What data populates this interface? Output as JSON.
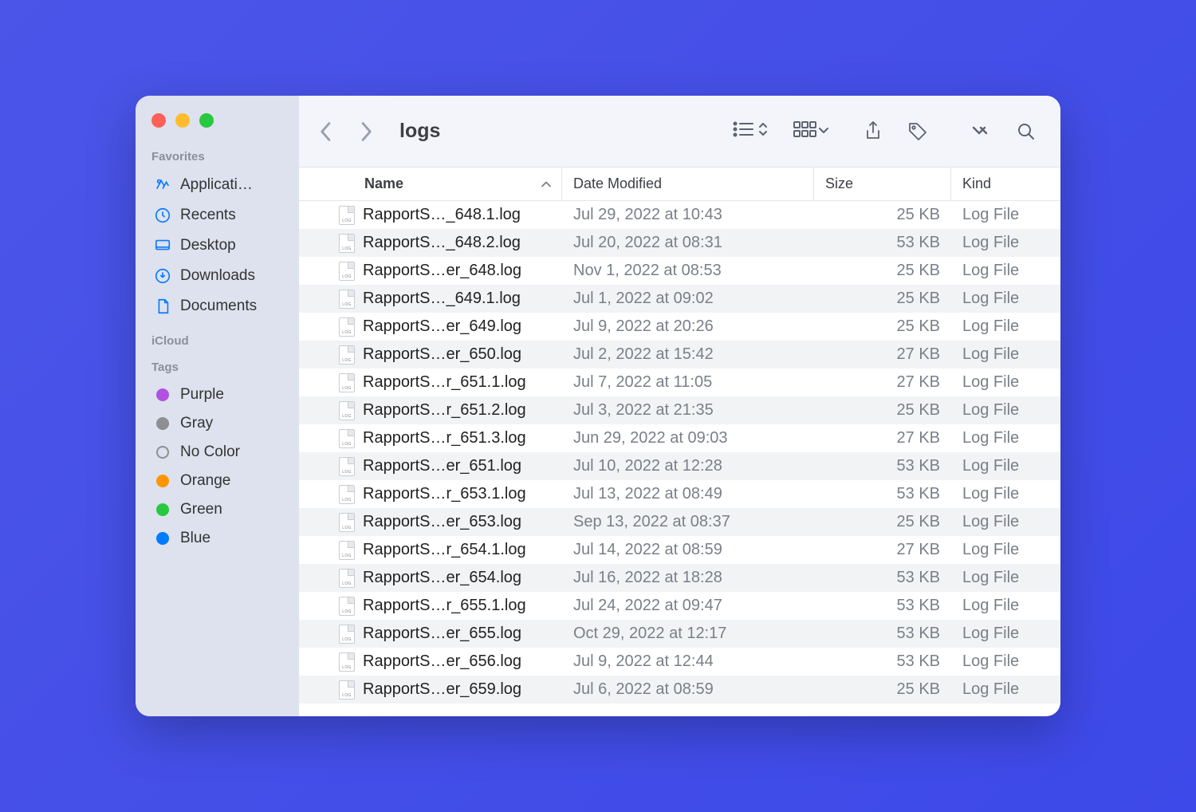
{
  "window": {
    "title": "logs"
  },
  "sidebar": {
    "sections": [
      {
        "label": "Favorites",
        "items": [
          {
            "icon": "applications",
            "label": "Applicati…"
          },
          {
            "icon": "recents",
            "label": "Recents"
          },
          {
            "icon": "desktop",
            "label": "Desktop"
          },
          {
            "icon": "downloads",
            "label": "Downloads"
          },
          {
            "icon": "documents",
            "label": "Documents"
          }
        ]
      },
      {
        "label": "iCloud",
        "items": []
      },
      {
        "label": "Tags",
        "items": [
          {
            "color": "#b151e0",
            "label": "Purple"
          },
          {
            "color": "#8e8e93",
            "label": "Gray"
          },
          {
            "color": "",
            "label": "No Color"
          },
          {
            "color": "#ff9500",
            "label": "Orange"
          },
          {
            "color": "#28c840",
            "label": "Green"
          },
          {
            "color": "#007aff",
            "label": "Blue"
          }
        ]
      }
    ]
  },
  "columns": {
    "name": "Name",
    "date": "Date Modified",
    "size": "Size",
    "kind": "Kind"
  },
  "files": [
    {
      "name": "RapportS…_648.1.log",
      "date": "Jul 29, 2022 at 10:43",
      "size": "25 KB",
      "kind": "Log File"
    },
    {
      "name": "RapportS…_648.2.log",
      "date": "Jul 20, 2022 at 08:31",
      "size": "53 KB",
      "kind": "Log File"
    },
    {
      "name": "RapportS…er_648.log",
      "date": "Nov 1, 2022 at 08:53",
      "size": "25 KB",
      "kind": "Log File"
    },
    {
      "name": "RapportS…_649.1.log",
      "date": "Jul 1, 2022 at 09:02",
      "size": "25 KB",
      "kind": "Log File"
    },
    {
      "name": "RapportS…er_649.log",
      "date": "Jul 9, 2022 at 20:26",
      "size": "25 KB",
      "kind": "Log File"
    },
    {
      "name": "RapportS…er_650.log",
      "date": "Jul 2, 2022 at 15:42",
      "size": "27 KB",
      "kind": "Log File"
    },
    {
      "name": "RapportS…r_651.1.log",
      "date": "Jul 7, 2022 at 11:05",
      "size": "27 KB",
      "kind": "Log File"
    },
    {
      "name": "RapportS…r_651.2.log",
      "date": "Jul 3, 2022 at 21:35",
      "size": "25 KB",
      "kind": "Log File"
    },
    {
      "name": "RapportS…r_651.3.log",
      "date": "Jun 29, 2022 at 09:03",
      "size": "27 KB",
      "kind": "Log File"
    },
    {
      "name": "RapportS…er_651.log",
      "date": "Jul 10, 2022 at 12:28",
      "size": "53 KB",
      "kind": "Log File"
    },
    {
      "name": "RapportS…r_653.1.log",
      "date": "Jul 13, 2022 at 08:49",
      "size": "53 KB",
      "kind": "Log File"
    },
    {
      "name": "RapportS…er_653.log",
      "date": "Sep 13, 2022 at 08:37",
      "size": "25 KB",
      "kind": "Log File"
    },
    {
      "name": "RapportS…r_654.1.log",
      "date": "Jul 14, 2022 at 08:59",
      "size": "27 KB",
      "kind": "Log File"
    },
    {
      "name": "RapportS…er_654.log",
      "date": "Jul 16, 2022 at 18:28",
      "size": "53 KB",
      "kind": "Log File"
    },
    {
      "name": "RapportS…r_655.1.log",
      "date": "Jul 24, 2022 at 09:47",
      "size": "53 KB",
      "kind": "Log File"
    },
    {
      "name": "RapportS…er_655.log",
      "date": "Oct 29, 2022 at 12:17",
      "size": "53 KB",
      "kind": "Log File"
    },
    {
      "name": "RapportS…er_656.log",
      "date": "Jul 9, 2022 at 12:44",
      "size": "53 KB",
      "kind": "Log File"
    },
    {
      "name": "RapportS…er_659.log",
      "date": "Jul 6, 2022 at 08:59",
      "size": "25 KB",
      "kind": "Log File"
    }
  ]
}
